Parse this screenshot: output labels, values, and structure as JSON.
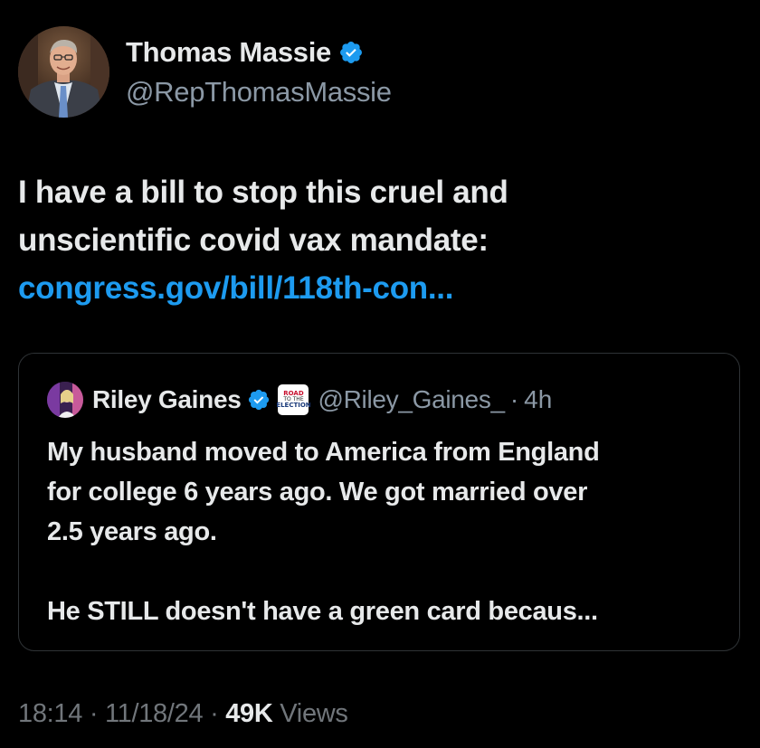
{
  "author": {
    "display_name": "Thomas Massie",
    "handle": "@RepThomasMassie",
    "verified": true,
    "avatar_icon": "profile-photo"
  },
  "tweet": {
    "line1": "I have a bill to stop this cruel and",
    "line2": "unscientific covid vax mandate:",
    "link": "congress.gov/bill/118th-con..."
  },
  "quoted_tweet": {
    "display_name": "Riley Gaines",
    "verified": true,
    "affiliate_badge": {
      "line1": "ROAD",
      "line2": "TO THE",
      "line3": "ELECTION"
    },
    "handle": "@Riley_Gaines_",
    "separator": "·",
    "time": "4h",
    "text_lines": [
      "My husband moved to America from England",
      "for college 6 years ago. We got married over",
      "2.5 years ago.",
      "",
      "He STILL doesn't have a green card becaus..."
    ]
  },
  "meta": {
    "time": "18:14",
    "date": "11/18/24",
    "separator": "·",
    "views_count": "49K",
    "views_label": "Views"
  },
  "colors": {
    "background": "#000000",
    "text_primary": "#e7e9ea",
    "text_secondary": "#71767b",
    "link": "#1d9bf0",
    "verified": "#1d9bf0",
    "border": "#2f3336"
  }
}
